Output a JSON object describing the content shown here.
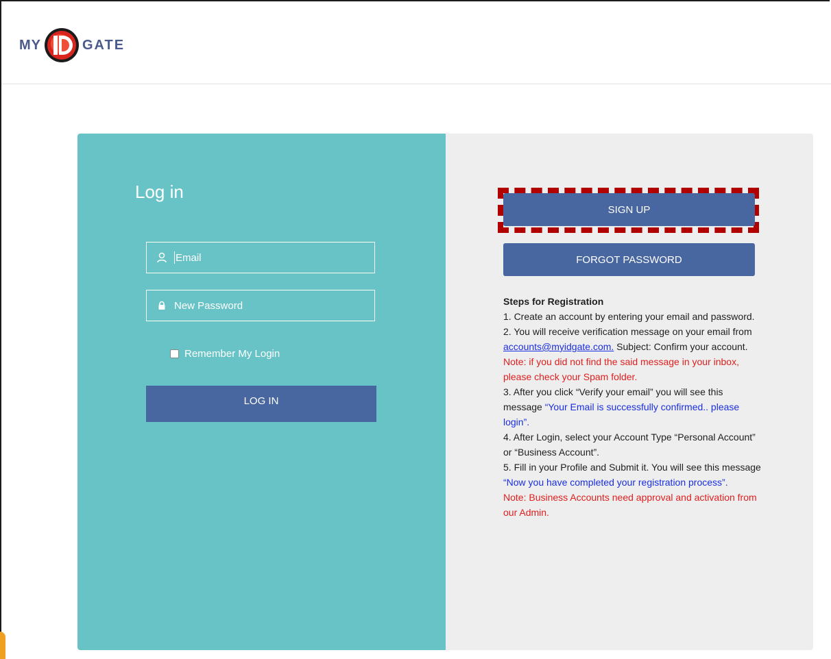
{
  "logo": {
    "prefix": "MY",
    "suffix": "GATE"
  },
  "login": {
    "title": "Log in",
    "email_placeholder": "Email",
    "password_placeholder": "New Password",
    "remember_label": "Remember My Login",
    "button_label": "LOG IN"
  },
  "register": {
    "signup_label": "SIGN UP",
    "forgot_label": "FORGOT PASSWORD",
    "steps_title": "Steps for Registration",
    "step1": "1. Create an account by entering your email and password.",
    "step2_pre": "2. You will receive verification message on your email from ",
    "step2_email": "accounts@myidgate.com.",
    "step2_post": " Subject: Confirm your account.",
    "note1": "Note: if you did not find the said message in your inbox, please check your Spam folder.",
    "step3_pre": "3. After you click “Verify your email” you will see this message ",
    "step3_msg": "“Your Email is successfully confirmed.. please login”.",
    "step4": "4. After Login, select your Account Type “Personal Account” or “Business Account”.",
    "step5_pre": "5. Fill in your Profile and Submit it. You will see this message ",
    "step5_msg": "“Now you have completed your registration process”.",
    "note2": "Note: Business Accounts need approval and activation from our Admin."
  },
  "colors": {
    "left_panel": "#68c3c6",
    "right_panel": "#eeeeee",
    "button": "#4866a0",
    "highlight": "#b00000",
    "note_red": "#e01e1e",
    "message_blue": "#1a2ee0"
  }
}
